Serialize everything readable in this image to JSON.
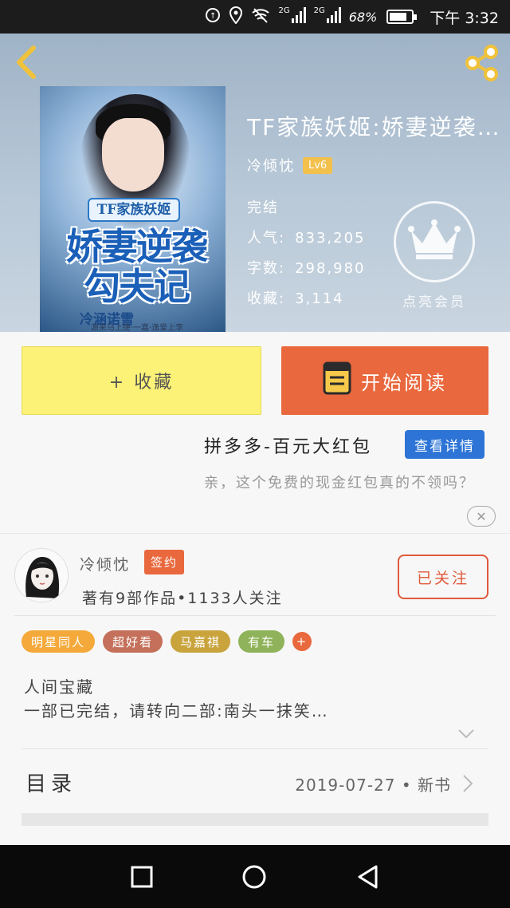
{
  "status_bar": {
    "icons": [
      "data-icon",
      "location-icon",
      "wifi-off-icon",
      "signal-icon",
      "signal-icon"
    ],
    "net1": "2G",
    "net2": "2G",
    "battery": "68%",
    "time": "下午 3:32"
  },
  "header": {
    "back_icon": "chevron-left-icon",
    "share_icon": "share-icon",
    "accent": "#f2c04b"
  },
  "book": {
    "cover": {
      "tag": "TF家族妖姬",
      "title": "娇妻逆袭勾夫记",
      "author": "冷涵诺雪",
      "slogan": "源来马上捷·一嘉·逸爱上李"
    },
    "title": "TF家族妖姬:娇妻逆袭…",
    "author": "冷倾忱",
    "level": "Lv6",
    "status": "完结",
    "popularity_label": "人气:",
    "popularity": "833,205",
    "words_label": "字数:",
    "words": "298,980",
    "favorites_label": "收藏:",
    "favorites": "3,114",
    "vip_label": "点亮会员"
  },
  "actions": {
    "collect": "+ 收藏",
    "read": "开始阅读",
    "collect_color": "#fbf277",
    "read_color": "#e9683d"
  },
  "ad": {
    "title": "拼多多-百元大红包",
    "button": "查看详情",
    "desc": "亲，这个免费的现金红包真的不领吗？",
    "close": "✕"
  },
  "author_card": {
    "name": "冷倾忱",
    "badge": "签约",
    "stats": "著有9部作品•1133人关注",
    "follow": "已关注"
  },
  "tags": [
    {
      "label": "明星同人",
      "color": "#f4a93a"
    },
    {
      "label": "超好看",
      "color": "#c4705a"
    },
    {
      "label": "马嘉祺",
      "color": "#c9a43d"
    },
    {
      "label": "有车",
      "color": "#8fb35a"
    },
    {
      "label": "+",
      "color": "#e9683d"
    }
  ],
  "intro": {
    "line1": "人间宝藏",
    "line2": "一部已完结，请转向二部:南头一抹笑…"
  },
  "catalog": {
    "label": "目录",
    "date": "2019-07-27 • 新书"
  },
  "nav": [
    "square-icon",
    "circle-icon",
    "triangle-back-icon"
  ]
}
